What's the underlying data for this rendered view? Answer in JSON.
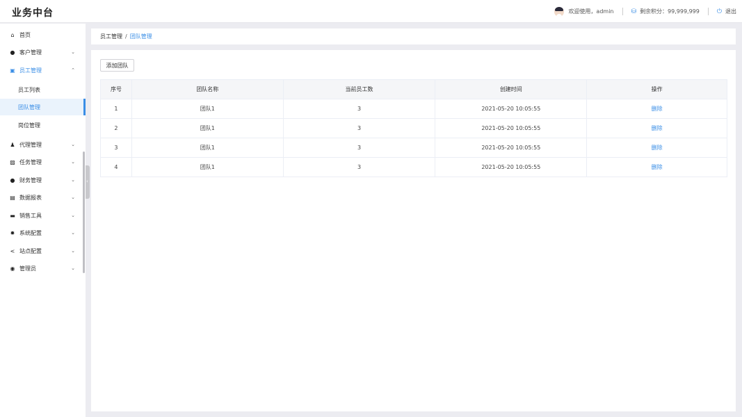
{
  "app": {
    "title": "业务中台"
  },
  "header": {
    "welcome": "欢迎使用，admin",
    "points_label": "剩余积分：99,999,999",
    "logout": "退出"
  },
  "sidebar": {
    "home": "首页",
    "customer": "客户管理",
    "employee": "员工管理",
    "employee_sub": [
      "员工列表",
      "团队管理",
      "岗位管理"
    ],
    "agent": "代理管理",
    "task": "任务管理",
    "finance": "财务管理",
    "report": "数据报表",
    "sales": "销售工具",
    "system": "系统配置",
    "site": "站点配置",
    "admin": "管理员"
  },
  "breadcrumb": {
    "parent": "员工管理",
    "separator": "/",
    "current": "团队管理"
  },
  "toolbar": {
    "add_team": "添加团队"
  },
  "table": {
    "columns": [
      "序号",
      "团队名称",
      "当前员工数",
      "创建时间",
      "操作"
    ],
    "rows": [
      {
        "index": "1",
        "name": "团队1",
        "count": "3",
        "created": "2021-05-20 10:05:55",
        "action": "删除"
      },
      {
        "index": "2",
        "name": "团队1",
        "count": "3",
        "created": "2021-05-20 10:05:55",
        "action": "删除"
      },
      {
        "index": "3",
        "name": "团队1",
        "count": "3",
        "created": "2021-05-20 10:05:55",
        "action": "删除"
      },
      {
        "index": "4",
        "name": "团队1",
        "count": "3",
        "created": "2021-05-20 10:05:55",
        "action": "删除"
      }
    ]
  },
  "colors": {
    "accent": "#3a8ee6",
    "selected_bg": "#eaf3fc",
    "page_bg": "#ececf1"
  }
}
